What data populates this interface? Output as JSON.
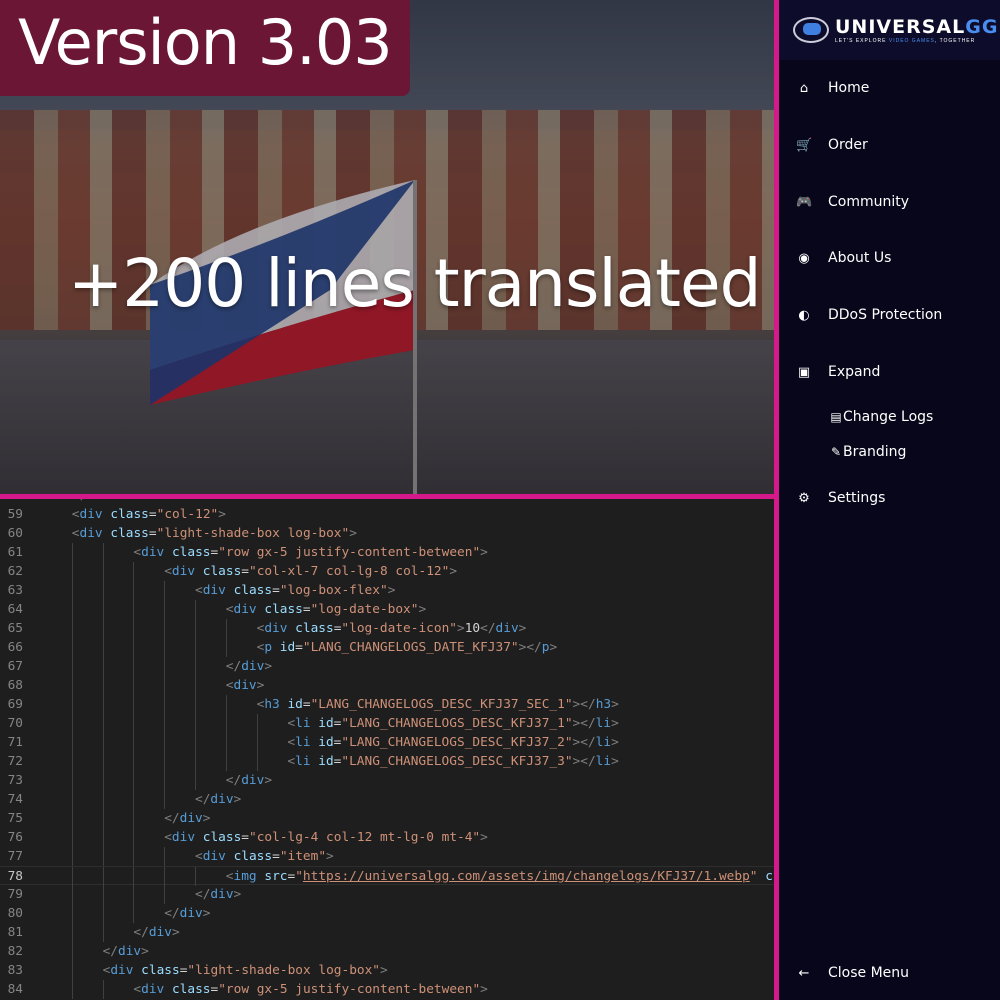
{
  "banner": {
    "version": "Version 3.03",
    "headline": "+200 lines translated",
    "colors": {
      "badge": "#6b1634",
      "divider": "#d6198a"
    }
  },
  "sidebar": {
    "logo": {
      "name_a": "UNIVERSAL",
      "name_b": "GG",
      "tagline_a": "LET'S EXPLORE ",
      "tagline_b": "VIDEO GAMES",
      "tagline_c": ", TOGETHER"
    },
    "items": [
      {
        "label": "Home",
        "icon": "home-icon",
        "glyph": "⌂"
      },
      {
        "label": "Order",
        "icon": "cart-icon",
        "glyph": "🛒"
      },
      {
        "label": "Community",
        "icon": "gamepad-icon",
        "glyph": "🎮"
      },
      {
        "label": "About Us",
        "icon": "circle-dot-icon",
        "glyph": "◉"
      },
      {
        "label": "DDoS Protection",
        "icon": "shield-icon",
        "glyph": "◐"
      },
      {
        "label": "Expand",
        "icon": "expand-icon",
        "glyph": "▣"
      }
    ],
    "subitems": [
      {
        "label": "Change Logs",
        "icon": "document-icon",
        "glyph": "▤"
      },
      {
        "label": "Branding",
        "icon": "branding-icon",
        "glyph": "✎"
      }
    ],
    "settings": {
      "label": "Settings",
      "icon": "gear-icon",
      "glyph": "⚙"
    },
    "close": {
      "label": "Close Menu",
      "icon": "arrow-left-icon",
      "glyph": "←"
    }
  },
  "editor": {
    "current_line": 78,
    "lines": [
      {
        "n": 59,
        "indent": 1,
        "text": "<div class=\"col-12\">"
      },
      {
        "n": 60,
        "indent": 1,
        "text": "<div class=\"light-shade-box log-box\">"
      },
      {
        "n": 61,
        "indent": 3,
        "text": "<div class=\"row gx-5 justify-content-between\">"
      },
      {
        "n": 62,
        "indent": 4,
        "text": "<div class=\"col-xl-7 col-lg-8 col-12\">"
      },
      {
        "n": 63,
        "indent": 5,
        "text": "<div class=\"log-box-flex\">"
      },
      {
        "n": 64,
        "indent": 6,
        "text": "<div class=\"log-date-box\">"
      },
      {
        "n": 65,
        "indent": 7,
        "text": "<div class=\"log-date-icon\">10</div>"
      },
      {
        "n": 66,
        "indent": 7,
        "text": "<p id=\"LANG_CHANGELOGS_DATE_KFJ37\"></p>"
      },
      {
        "n": 67,
        "indent": 6,
        "text": "</div>"
      },
      {
        "n": 68,
        "indent": 6,
        "text": "<div>"
      },
      {
        "n": 69,
        "indent": 7,
        "text": "<h3 id=\"LANG_CHANGELOGS_DESC_KFJ37_SEC_1\"></h3>"
      },
      {
        "n": 70,
        "indent": 8,
        "text": "<li id=\"LANG_CHANGELOGS_DESC_KFJ37_1\"></li>"
      },
      {
        "n": 71,
        "indent": 8,
        "text": "<li id=\"LANG_CHANGELOGS_DESC_KFJ37_2\"></li>"
      },
      {
        "n": 72,
        "indent": 8,
        "text": "<li id=\"LANG_CHANGELOGS_DESC_KFJ37_3\"></li>"
      },
      {
        "n": 73,
        "indent": 6,
        "text": "</div>"
      },
      {
        "n": 74,
        "indent": 5,
        "text": "</div>"
      },
      {
        "n": 75,
        "indent": 4,
        "text": "</div>"
      },
      {
        "n": 76,
        "indent": 4,
        "text": "<div class=\"col-lg-4 col-12 mt-lg-0 mt-4\">"
      },
      {
        "n": 77,
        "indent": 5,
        "text": "<div class=\"item\">"
      },
      {
        "n": 78,
        "indent": 6,
        "text": "<img src=\"https://universalgg.com/assets/img/changelogs/KFJ37/1.webp\" c"
      },
      {
        "n": 79,
        "indent": 5,
        "text": "</div>"
      },
      {
        "n": 80,
        "indent": 4,
        "text": "</div>"
      },
      {
        "n": 81,
        "indent": 3,
        "text": "</div>"
      },
      {
        "n": 82,
        "indent": 2,
        "text": "</div>"
      },
      {
        "n": 83,
        "indent": 2,
        "text": "<div class=\"light-shade-box log-box\">"
      },
      {
        "n": 84,
        "indent": 3,
        "text": "<div class=\"row gx-5 justify-content-between\">"
      }
    ]
  }
}
